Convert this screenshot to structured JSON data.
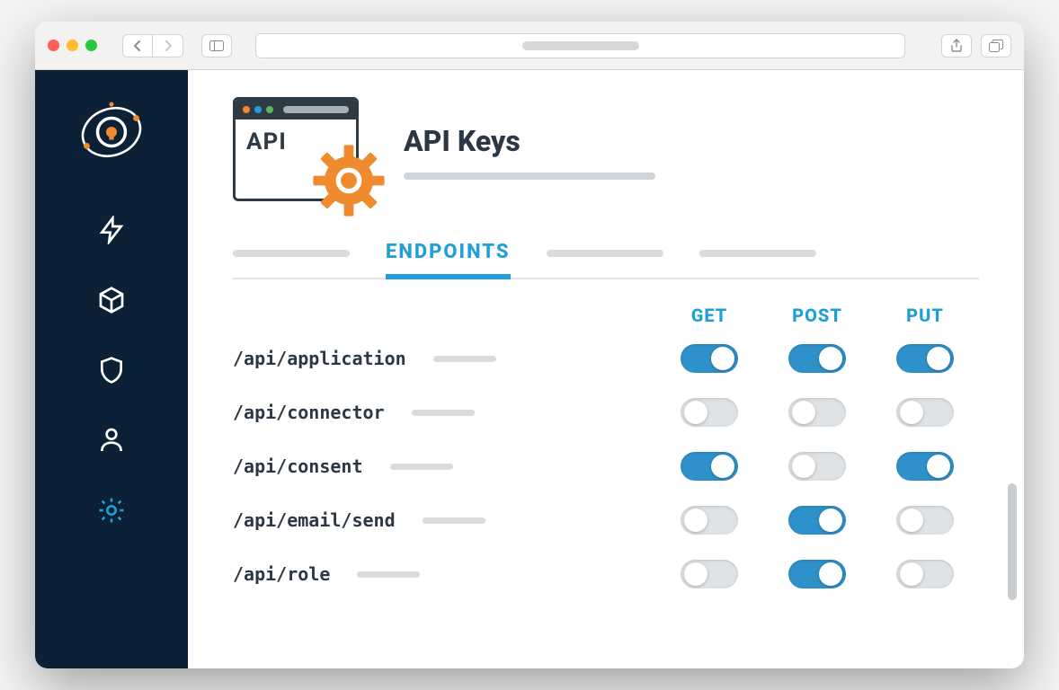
{
  "header": {
    "icon_label": "API",
    "title": "API Keys"
  },
  "tabs": {
    "active": "ENDPOINTS"
  },
  "columns": [
    "GET",
    "POST",
    "PUT"
  ],
  "endpoints": [
    {
      "path": "/api/application",
      "get": true,
      "post": true,
      "put": true
    },
    {
      "path": "/api/connector",
      "get": false,
      "post": false,
      "put": false
    },
    {
      "path": "/api/consent",
      "get": true,
      "post": false,
      "put": true
    },
    {
      "path": "/api/email/send",
      "get": false,
      "post": true,
      "put": false
    },
    {
      "path": "/api/role",
      "get": false,
      "post": true,
      "put": false
    }
  ],
  "sidebar": {
    "items": [
      {
        "name": "activity",
        "icon": "bolt"
      },
      {
        "name": "packages",
        "icon": "cube"
      },
      {
        "name": "security",
        "icon": "shield"
      },
      {
        "name": "users",
        "icon": "user"
      },
      {
        "name": "settings",
        "icon": "gear",
        "active": true
      }
    ]
  }
}
